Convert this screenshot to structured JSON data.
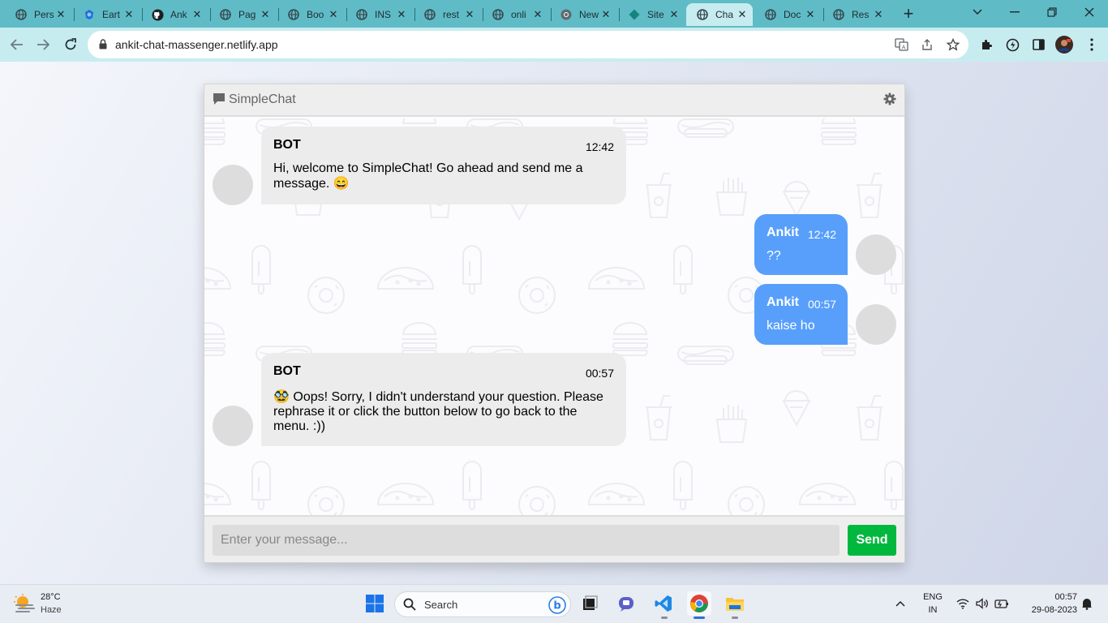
{
  "browser": {
    "tabs": [
      {
        "title": "Pers",
        "icon": "globe-icon"
      },
      {
        "title": "Eart",
        "icon": "earth-logo-icon"
      },
      {
        "title": "Ank",
        "icon": "github-icon"
      },
      {
        "title": "Pag",
        "icon": "globe-icon"
      },
      {
        "title": "Boo",
        "icon": "globe-icon"
      },
      {
        "title": "INS",
        "icon": "globe-icon"
      },
      {
        "title": "rest",
        "icon": "globe-icon"
      },
      {
        "title": "onli",
        "icon": "globe-icon"
      },
      {
        "title": "New",
        "icon": "chrome-icon"
      },
      {
        "title": "Site",
        "icon": "netlify-icon"
      },
      {
        "title": "Cha",
        "icon": "globe-icon",
        "active": true
      },
      {
        "title": "Doc",
        "icon": "globe-icon"
      },
      {
        "title": "Res",
        "icon": "globe-icon"
      }
    ],
    "url": "ankit-chat-massenger.netlify.app"
  },
  "chat": {
    "title": "SimpleChat",
    "messages": [
      {
        "side": "left",
        "name": "BOT",
        "time": "12:42",
        "text": "Hi, welcome to SimpleChat! Go ahead and send me a message. 😄"
      },
      {
        "side": "right",
        "name": "Ankit",
        "time": "12:42",
        "text": "??"
      },
      {
        "side": "right",
        "name": "Ankit",
        "time": "00:57",
        "text": "kaise ho"
      },
      {
        "side": "left",
        "name": "BOT",
        "time": "00:57",
        "text": "🥸 Oops! Sorry, I didn't understand your question. Please rephrase it or click the button below to go back to the menu. :))"
      }
    ],
    "input_placeholder": "Enter your message...",
    "send_label": "Send",
    "colors": {
      "user_bubble": "#579ffb",
      "bot_bubble": "#ececec",
      "send_button": "#00b83d"
    }
  },
  "taskbar": {
    "weather": {
      "temp": "28°C",
      "condition": "Haze"
    },
    "search_label": "Search",
    "language": {
      "line1": "ENG",
      "line2": "IN"
    },
    "clock": {
      "time": "00:57",
      "date": "29-08-2023"
    }
  }
}
